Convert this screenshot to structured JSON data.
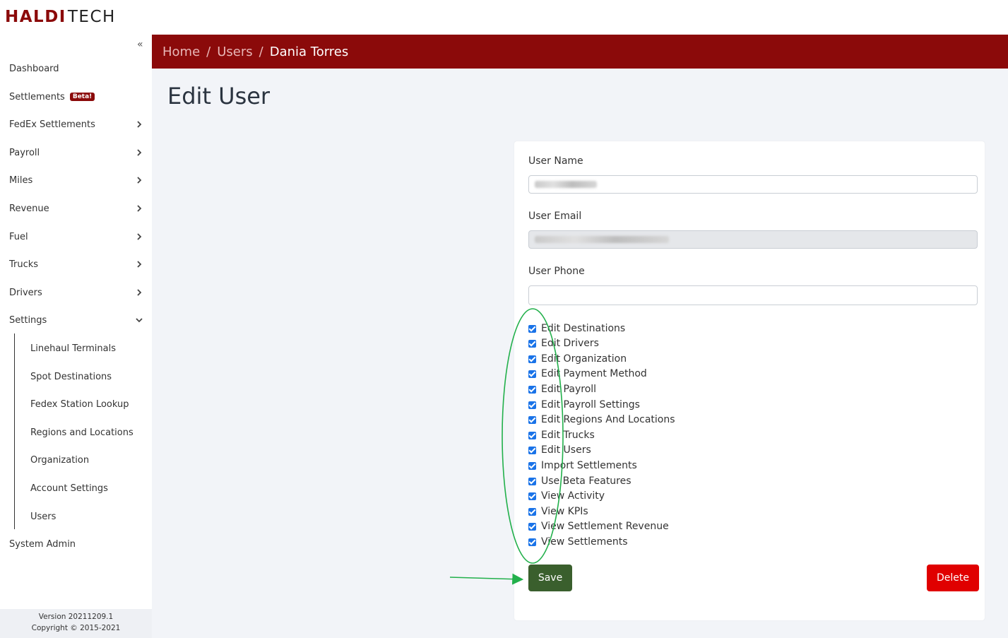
{
  "brand": {
    "logo_part1": "HALDI",
    "logo_part2": "TECH",
    "accent": "#8b0a0a"
  },
  "sidebar": {
    "collapse_icon": "double-chevron-left-icon",
    "items": [
      {
        "label": "Dashboard",
        "has_submenu": false
      },
      {
        "label": "Settlements",
        "badge": "Beta!",
        "has_submenu": false
      },
      {
        "label": "FedEx Settlements",
        "has_submenu": true
      },
      {
        "label": "Payroll",
        "has_submenu": true
      },
      {
        "label": "Miles",
        "has_submenu": true
      },
      {
        "label": "Revenue",
        "has_submenu": true
      },
      {
        "label": "Fuel",
        "has_submenu": true
      },
      {
        "label": "Trucks",
        "has_submenu": true
      },
      {
        "label": "Drivers",
        "has_submenu": true
      },
      {
        "label": "Settings",
        "has_submenu": true,
        "expanded": true
      },
      {
        "label": "System Admin",
        "has_submenu": false
      }
    ],
    "settings_subitems": [
      "Linehaul Terminals",
      "Spot Destinations",
      "Fedex Station Lookup",
      "Regions and Locations",
      "Organization",
      "Account Settings",
      "Users"
    ],
    "footer": {
      "version": "Version 20211209.1",
      "copyright": "Copyright © 2015-2021"
    }
  },
  "breadcrumb": {
    "home": "Home",
    "users": "Users",
    "current": "Dania Torres",
    "separator": "/"
  },
  "page": {
    "title": "Edit User"
  },
  "form": {
    "user_name_label": "User Name",
    "user_email_label": "User Email",
    "user_phone_label": "User Phone",
    "user_phone_value": "",
    "permissions": [
      {
        "label": "Edit Destinations",
        "checked": true
      },
      {
        "label": "Edit Drivers",
        "checked": true
      },
      {
        "label": "Edit Organization",
        "checked": true
      },
      {
        "label": "Edit Payment Method",
        "checked": true
      },
      {
        "label": "Edit Payroll",
        "checked": true
      },
      {
        "label": "Edit Payroll Settings",
        "checked": true
      },
      {
        "label": "Edit Regions And Locations",
        "checked": true
      },
      {
        "label": "Edit Trucks",
        "checked": true
      },
      {
        "label": "Edit Users",
        "checked": true
      },
      {
        "label": "Import Settlements",
        "checked": true
      },
      {
        "label": "Use Beta Features",
        "checked": true
      },
      {
        "label": "View Activity",
        "checked": true
      },
      {
        "label": "View KPIs",
        "checked": true
      },
      {
        "label": "View Settlement Revenue",
        "checked": true
      },
      {
        "label": "View Settlements",
        "checked": true
      }
    ],
    "save_label": "Save",
    "delete_label": "Delete",
    "save_color": "#3a5f2d",
    "delete_color": "#e00000"
  },
  "annotations": {
    "color": "#22b04b",
    "shapes": [
      "ellipse-around-checkboxes",
      "arrow-to-save-button"
    ]
  }
}
